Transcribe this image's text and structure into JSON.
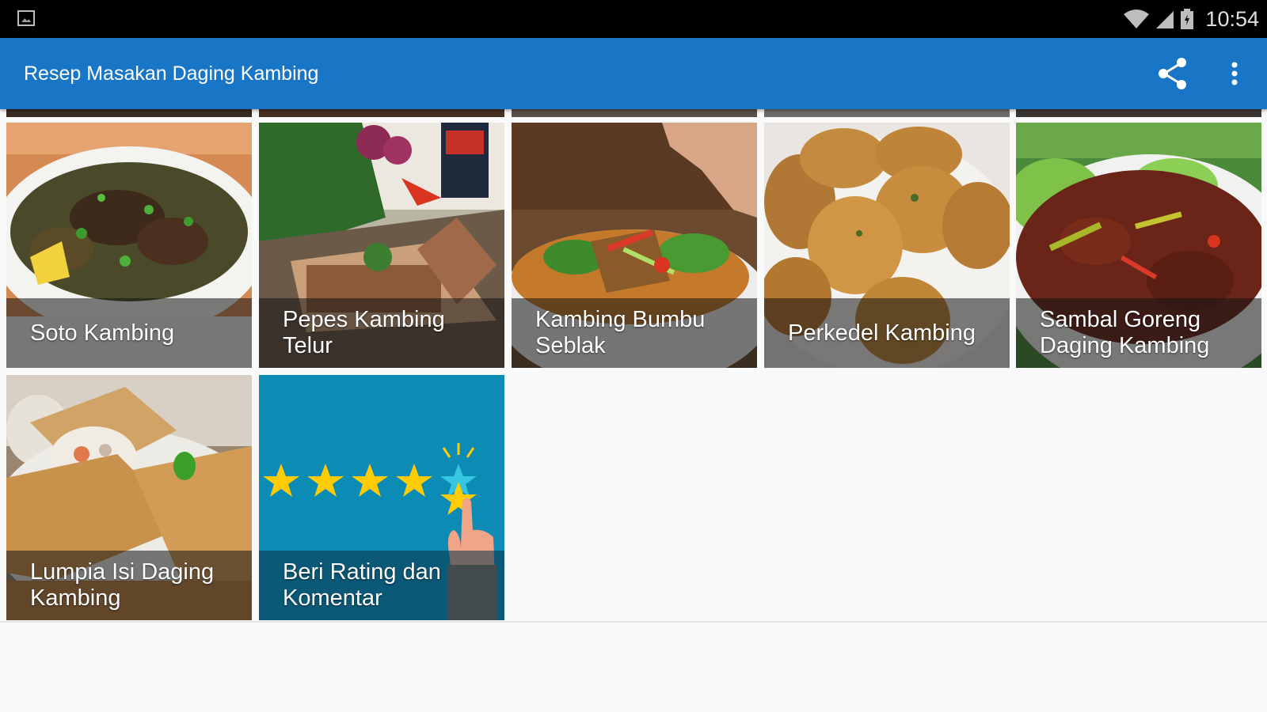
{
  "status_bar": {
    "time": "10:54",
    "icons": [
      "gallery-icon",
      "wifi-icon",
      "signal-icon",
      "battery-icon"
    ]
  },
  "app_bar": {
    "title": "Resep Masakan Daging Kambing",
    "actions": [
      "share-icon",
      "more-vert-icon"
    ],
    "color": "#1976c6"
  },
  "grid": {
    "items": [
      {
        "label": "Soto Kambing"
      },
      {
        "label": "Pepes Kambing Telur"
      },
      {
        "label": "Kambing Bumbu Seblak"
      },
      {
        "label": "Perkedel Kambing"
      },
      {
        "label": "Sambal Goreng Daging Kambing"
      },
      {
        "label": "Lumpia Isi Daging Kambing"
      },
      {
        "label": "Beri Rating dan Komentar"
      }
    ]
  },
  "colors": {
    "rating_bg": "#0c8bb4",
    "star": "#ffcb05"
  }
}
